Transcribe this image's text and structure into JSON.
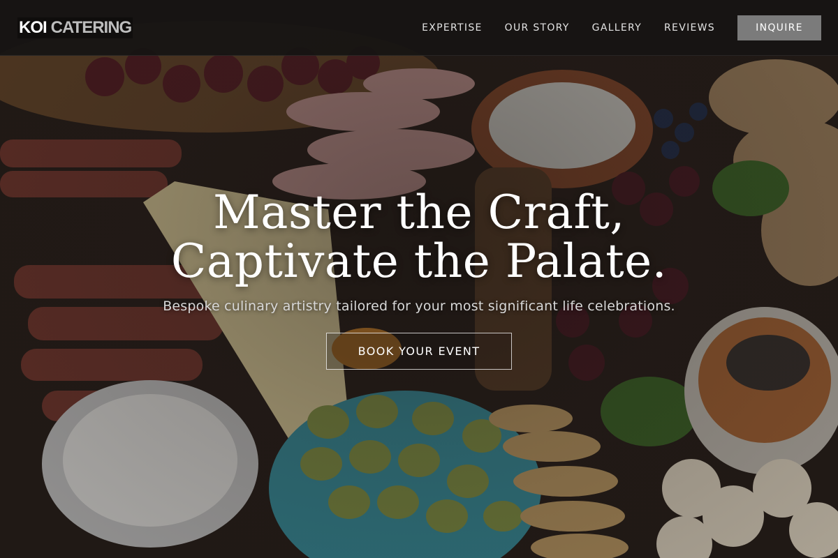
{
  "brand": {
    "logo_primary": "KOI",
    "logo_secondary": "CATERING"
  },
  "nav": {
    "items": [
      {
        "label": "EXPERTISE"
      },
      {
        "label": "OUR STORY"
      },
      {
        "label": "GALLERY"
      },
      {
        "label": "REVIEWS"
      }
    ],
    "inquire_label": "INQUIRE"
  },
  "hero": {
    "title_line1": "Master the Craft,",
    "title_line2": "Captivate the Palate.",
    "subtitle": "Bespoke culinary artistry tailored for your most significant life celebrations.",
    "cta_label": "BOOK YOUR EVENT"
  },
  "colors": {
    "header_bg": "#161413",
    "inquire_bg": "#7b7b7b",
    "text_primary": "#ffffff",
    "text_muted": "#d8d8d8"
  }
}
